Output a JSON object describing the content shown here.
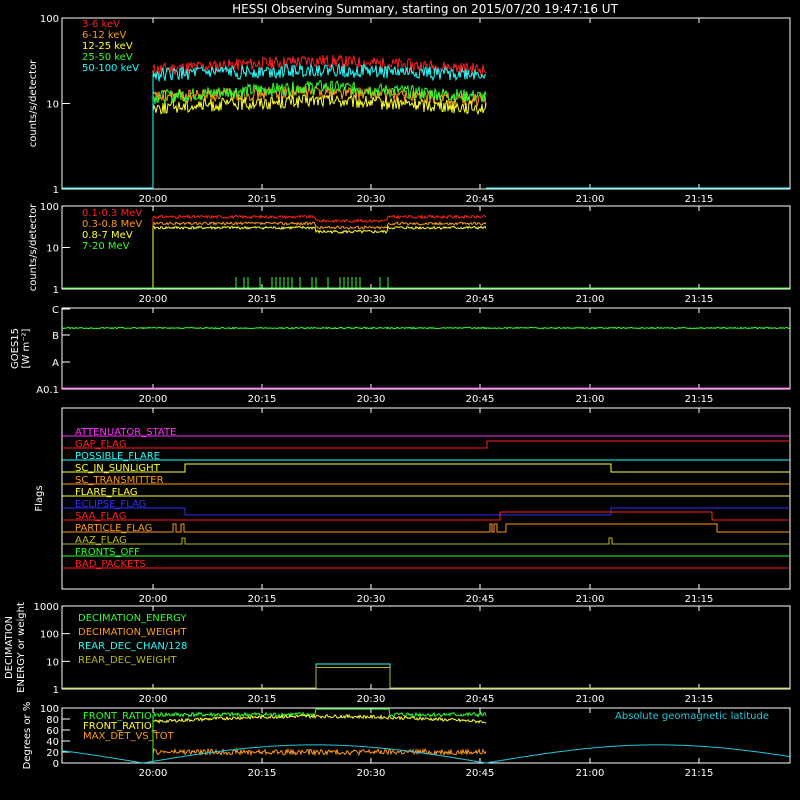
{
  "title": "HESSI Observing Summary, starting on 2015/07/20 19:47:16 UT",
  "x_tick_labels": [
    "20:00",
    "20:15",
    "20:30",
    "20:45",
    "21:00",
    "21:15"
  ],
  "chart_data": [
    {
      "type": "line",
      "ylabel": "counts/s/detector",
      "yscale": "log",
      "ylim": [
        1,
        100
      ],
      "ytick_labels": [
        "1",
        "10",
        "100"
      ],
      "series": [
        {
          "name": "3-6 keV",
          "color": "#ff2020",
          "start_value": 25,
          "mid_value": 32,
          "end_value": 25
        },
        {
          "name": "6-12 keV",
          "color": "#ff9a1a",
          "start_value": 12,
          "mid_value": 14,
          "end_value": 11
        },
        {
          "name": "12-25 keV",
          "color": "#ffff30",
          "start_value": 9,
          "mid_value": 11,
          "end_value": 9
        },
        {
          "name": "25-50 keV",
          "color": "#30ff30",
          "start_value": 12,
          "mid_value": 16,
          "end_value": 12
        },
        {
          "name": "50-100 keV",
          "color": "#20ffff",
          "start_value": 22,
          "mid_value": 25,
          "end_value": 22
        }
      ]
    },
    {
      "type": "line",
      "ylabel": "counts/s/detector",
      "yscale": "log",
      "ylim": [
        1,
        100
      ],
      "ytick_labels": [
        "1",
        "10",
        "100"
      ],
      "series": [
        {
          "name": "0.1-0.3 MeV",
          "color": "#ff2020",
          "level": 55
        },
        {
          "name": "0.3-0.8 MeV",
          "color": "#ff9a1a",
          "level": 38
        },
        {
          "name": "0.8-7 MeV",
          "color": "#ffff30",
          "level": 30
        },
        {
          "name": "7-20 MeV",
          "color": "#30ff30",
          "level": 1
        }
      ]
    },
    {
      "type": "line",
      "ylabel": "GOES15",
      "yunits": "[W m⁻²]",
      "ytick_labels": [
        "A0.1",
        "A",
        "B",
        "C"
      ],
      "series": [
        {
          "name": "GOES",
          "color": "#30ff30",
          "level": "B6"
        }
      ]
    },
    {
      "type": "step",
      "ylabel": "Flags",
      "flags": [
        {
          "name": "ATTENUATOR_STATE",
          "color": "#ff30ff"
        },
        {
          "name": "GAP_FLAG",
          "color": "#ff2020"
        },
        {
          "name": "POSSIBLE_FLARE",
          "color": "#20ffff"
        },
        {
          "name": "SC_IN_SUNLIGHT",
          "color": "#ffff30"
        },
        {
          "name": "SC_TRANSMITTER",
          "color": "#ff9a1a"
        },
        {
          "name": "FLARE_FLAG",
          "color": "#ffff30"
        },
        {
          "name": "ECLIPSE_FLAG",
          "color": "#3030ff"
        },
        {
          "name": "SAA_FLAG",
          "color": "#ff2020"
        },
        {
          "name": "PARTICLE_FLAG",
          "color": "#ff9a1a"
        },
        {
          "name": "AAZ_FLAG",
          "color": "#b8b820"
        },
        {
          "name": "FRONTS_OFF",
          "color": "#30ff30"
        },
        {
          "name": "BAD_PACKETS",
          "color": "#ff2020"
        }
      ]
    },
    {
      "type": "line",
      "ylabel_lines": [
        "DECIMATION",
        "ENERGY or weight"
      ],
      "yscale": "log",
      "ylim": [
        1,
        1000
      ],
      "ytick_labels": [
        "1",
        "10",
        "100",
        "1000"
      ],
      "series": [
        {
          "name": "DECIMATION_ENERGY",
          "color": "#30ff30"
        },
        {
          "name": "DECIMATION_WEIGHT",
          "color": "#ff9a1a"
        },
        {
          "name": "REAR_DEC_CHAN/128",
          "color": "#20ffff",
          "value": 8
        },
        {
          "name": "REAR_DEC_WEIGHT",
          "color": "#b8b820",
          "value": 6
        }
      ]
    },
    {
      "type": "line",
      "ylabel": "Degrees or %",
      "ylim": [
        0,
        100
      ],
      "ytick_labels": [
        "0",
        "20",
        "40",
        "60",
        "80",
        "100"
      ],
      "annotation": "Absolute geomagnetic latitude",
      "series": [
        {
          "name": "FRONT_RATIO",
          "color": "#30ff30",
          "level": 88
        },
        {
          "name": "FRONT_RATIO_",
          "color": "#ffff30",
          "level": 75
        },
        {
          "name": "MAX_DET_VS_TOT",
          "color": "#ff9a1a",
          "level": 20
        },
        {
          "name": "Absolute geomagnetic latitude",
          "color": "#20c8e0",
          "peak": 33
        }
      ]
    }
  ]
}
